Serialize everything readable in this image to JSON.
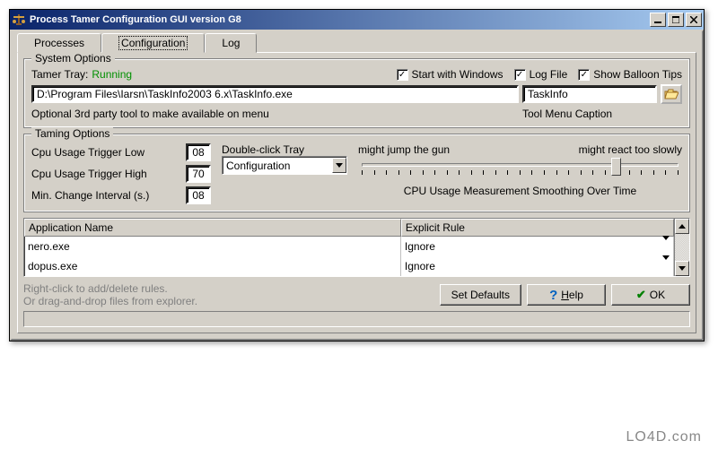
{
  "window": {
    "title": "Process Tamer Configuration GUI version G8"
  },
  "tabs": {
    "items": [
      {
        "label": "Processes"
      },
      {
        "label": "Configuration"
      },
      {
        "label": "Log"
      }
    ],
    "active": 1
  },
  "system_options": {
    "legend": "System Options",
    "tray_label": "Tamer Tray:",
    "tray_status": "Running",
    "start_with_windows_label": "Start with Windows",
    "log_file_label": "Log File",
    "show_balloon_label": "Show Balloon Tips",
    "tool_path": "D:\\Program Files\\Iarsn\\TaskInfo2003 6.x\\TaskInfo.exe",
    "tool_caption": "TaskInfo",
    "tool_path_hint": "Optional 3rd party tool to make available on menu",
    "tool_caption_hint": "Tool Menu Caption"
  },
  "taming_options": {
    "legend": "Taming Options",
    "cpu_low_label": "Cpu Usage Trigger Low",
    "cpu_low_value": "08",
    "cpu_high_label": "Cpu Usage Trigger High",
    "cpu_high_value": "70",
    "min_change_label": "Min. Change Interval (s.)",
    "min_change_value": "08",
    "double_click_label": "Double-click Tray",
    "double_click_value": "Configuration",
    "slider_left_hint": "might jump the gun",
    "slider_right_hint": "might react too slowly",
    "slider_caption": "CPU Usage Measurement Smoothing Over Time"
  },
  "rules_table": {
    "headers": {
      "app": "Application Name",
      "rule": "Explicit Rule"
    },
    "rows": [
      {
        "app": "nero.exe",
        "rule": "Ignore"
      },
      {
        "app": "dopus.exe",
        "rule": "Ignore"
      }
    ]
  },
  "hint": {
    "line1": "Right-click to add/delete rules.",
    "line2": "Or drag-and-drop files from explorer."
  },
  "buttons": {
    "set_defaults": "Set Defaults",
    "help": "Help",
    "ok": "OK"
  },
  "watermark": "LO4D.com"
}
